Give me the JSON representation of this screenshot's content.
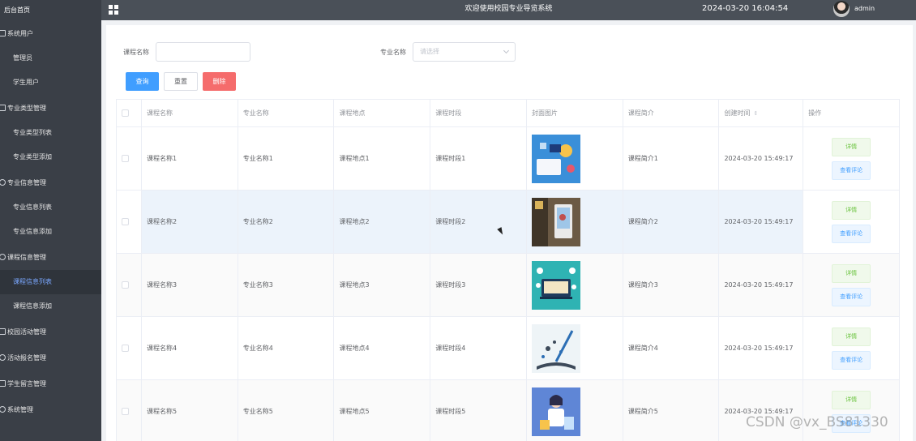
{
  "sidebar": {
    "home": "后台首页",
    "groups": [
      {
        "label": "系统用户",
        "items": [
          "管理员",
          "学生用户"
        ]
      },
      {
        "label": "专业类型管理",
        "items": [
          "专业类型列表",
          "专业类型添加"
        ]
      },
      {
        "label": "专业信息管理",
        "items": [
          "专业信息列表",
          "专业信息添加"
        ]
      },
      {
        "label": "课程信息管理",
        "items": [
          "课程信息列表",
          "课程信息添加"
        ]
      },
      {
        "label": "校园活动管理",
        "items": []
      },
      {
        "label": "活动报名管理",
        "items": []
      },
      {
        "label": "学生留言管理",
        "items": []
      },
      {
        "label": "系统管理",
        "items": []
      }
    ],
    "active_item": "课程信息列表"
  },
  "topbar": {
    "title": "欢迎使用校园专业导览系统",
    "datetime": "2024-03-20 16:04:54",
    "username": "admin"
  },
  "search": {
    "course_label": "课程名称",
    "course_value": "",
    "major_label": "专业名称",
    "major_placeholder": "请选择"
  },
  "buttons": {
    "query": "查询",
    "reset": "重置",
    "delete": "删除"
  },
  "table": {
    "headers": [
      "课程名称",
      "专业名称",
      "课程地点",
      "课程时段",
      "封面图片",
      "课程简介",
      "创建时间",
      "操作"
    ],
    "sort_glyph": "⇕",
    "rows": [
      {
        "name": "课程名称1",
        "major": "专业名称1",
        "location": "课程地点1",
        "period": "课程时段1",
        "intro": "课程简介1",
        "created": "2024-03-20 15:49:17"
      },
      {
        "name": "课程名称2",
        "major": "专业名称2",
        "location": "课程地点2",
        "period": "课程时段2",
        "intro": "课程简介2",
        "created": "2024-03-20 15:49:17"
      },
      {
        "name": "课程名称3",
        "major": "专业名称3",
        "location": "课程地点3",
        "period": "课程时段3",
        "intro": "课程简介3",
        "created": "2024-03-20 15:49:17"
      },
      {
        "name": "课程名称4",
        "major": "专业名称4",
        "location": "课程地点4",
        "period": "课程时段4",
        "intro": "课程简介4",
        "created": "2024-03-20 15:49:17"
      },
      {
        "name": "课程名称5",
        "major": "专业名称5",
        "location": "课程地点5",
        "period": "课程时段5",
        "intro": "课程简介5",
        "created": "2024-03-20 15:49:17"
      }
    ],
    "row_actions": {
      "detail": "详情",
      "review": "查看评论"
    }
  },
  "watermark": "CSDN @vx_BS81330",
  "colors": {
    "primary": "#409eff",
    "danger": "#f56c6c",
    "success": "#67c23a",
    "sidebar_bg": "#3a3f47",
    "topbar_bg": "#4a5058"
  }
}
